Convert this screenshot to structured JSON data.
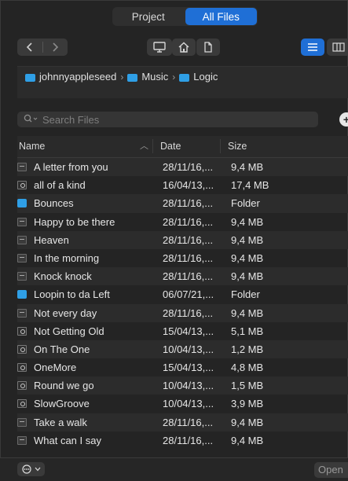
{
  "segment": {
    "project_label": "Project",
    "all_files_label": "All Files"
  },
  "breadcrumb": {
    "items": [
      "johnnyappleseed",
      "Music",
      "Logic"
    ]
  },
  "search": {
    "placeholder": "Search Files"
  },
  "table": {
    "headers": {
      "name": "Name",
      "date": "Date",
      "size": "Size"
    },
    "rows": [
      {
        "name": "A letter from you",
        "date": "28/11/16,...",
        "size": "9,4 MB",
        "kind": "file"
      },
      {
        "name": "all of a kind",
        "date": "16/04/13,...",
        "size": "17,4 MB",
        "kind": "audio"
      },
      {
        "name": "Bounces",
        "date": "28/11/16,...",
        "size": "Folder",
        "kind": "folder"
      },
      {
        "name": "Happy to be there",
        "date": "28/11/16,...",
        "size": "9,4 MB",
        "kind": "file"
      },
      {
        "name": "Heaven",
        "date": "28/11/16,...",
        "size": "9,4 MB",
        "kind": "file"
      },
      {
        "name": "In the morning",
        "date": "28/11/16,...",
        "size": "9,4 MB",
        "kind": "file"
      },
      {
        "name": "Knock knock",
        "date": "28/11/16,...",
        "size": "9,4 MB",
        "kind": "file"
      },
      {
        "name": "Loopin to da Left",
        "date": "06/07/21,...",
        "size": "Folder",
        "kind": "folder"
      },
      {
        "name": "Not every day",
        "date": "28/11/16,...",
        "size": "9,4 MB",
        "kind": "file"
      },
      {
        "name": "Not Getting Old",
        "date": "15/04/13,...",
        "size": "5,1 MB",
        "kind": "audio"
      },
      {
        "name": "On The One",
        "date": "10/04/13,...",
        "size": "1,2 MB",
        "kind": "audio"
      },
      {
        "name": "OneMore",
        "date": "15/04/13,...",
        "size": "4,8 MB",
        "kind": "audio"
      },
      {
        "name": "Round we go",
        "date": "10/04/13,...",
        "size": "1,5 MB",
        "kind": "audio"
      },
      {
        "name": "SlowGroove",
        "date": "10/04/13,...",
        "size": "3,9 MB",
        "kind": "audio"
      },
      {
        "name": "Take a walk",
        "date": "28/11/16,...",
        "size": "9,4 MB",
        "kind": "file"
      },
      {
        "name": "What can I say",
        "date": "28/11/16,...",
        "size": "9,4 MB",
        "kind": "file"
      }
    ]
  },
  "footer": {
    "open_label": "Open"
  }
}
